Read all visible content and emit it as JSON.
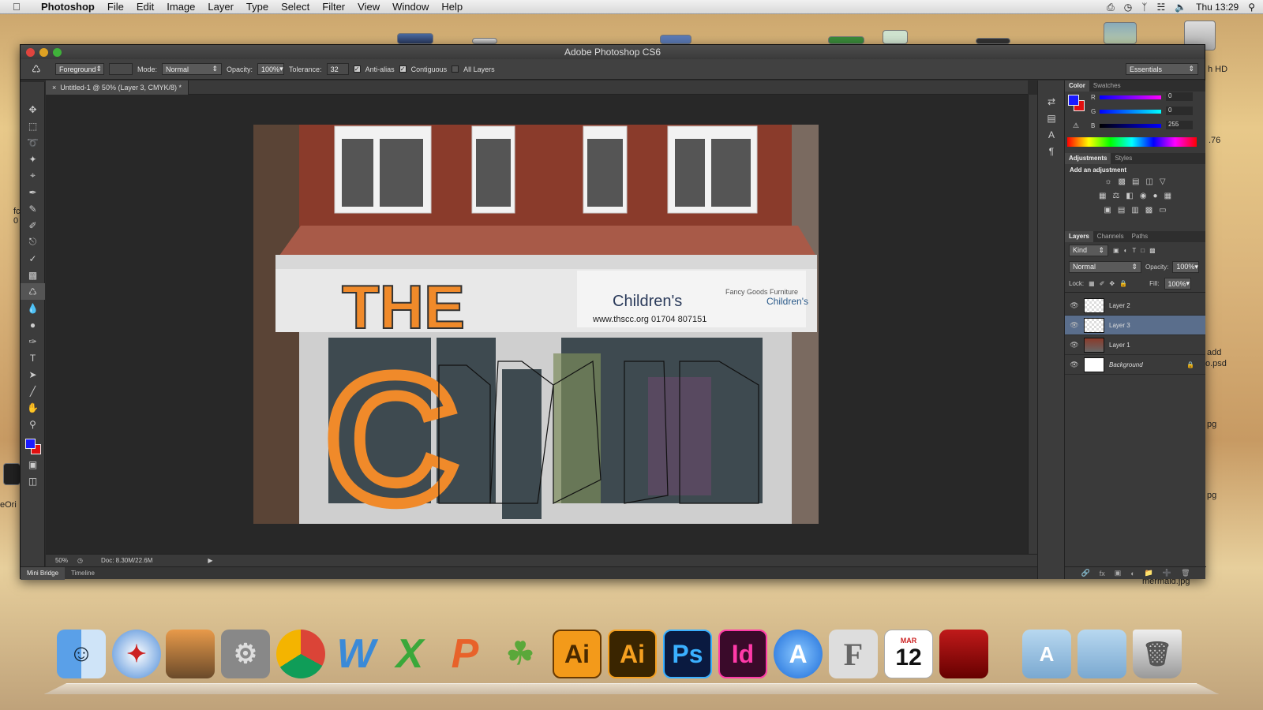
{
  "menubar": {
    "app_name": "Photoshop",
    "items": [
      "File",
      "Edit",
      "Image",
      "Layer",
      "Type",
      "Select",
      "Filter",
      "View",
      "Window",
      "Help"
    ],
    "clock": "Thu 13:29"
  },
  "window": {
    "title": "Adobe Photoshop CS6"
  },
  "options": {
    "tool_preset": "Foreground",
    "mode_label": "Mode:",
    "mode_value": "Normal",
    "opacity_label": "Opacity:",
    "opacity_value": "100%",
    "tolerance_label": "Tolerance:",
    "tolerance_value": "32",
    "antialias_label": "Anti-alias",
    "contiguous_label": "Contiguous",
    "all_layers_label": "All Layers",
    "workspace": "Essentials"
  },
  "document": {
    "tab_title": "Untitled-1 @ 50% (Layer 3, CMYK/8) *"
  },
  "photo": {
    "sign_line1": "Children's",
    "sign_line2": "www.thscc.org   01704 807151",
    "sign_side": "Fancy Goods Furniture",
    "sign_logo": "Children's",
    "word_the": "THE",
    "letter_c": "C"
  },
  "status": {
    "zoom": "50%",
    "doc": "Doc: 8.30M/22.6M"
  },
  "bottom_tabs": [
    "Mini Bridge",
    "Timeline"
  ],
  "color_panel": {
    "tabs": [
      "Color",
      "Swatches"
    ],
    "r_label": "R",
    "r_value": "0",
    "g_label": "G",
    "g_value": "0",
    "b_label": "B",
    "b_value": "255",
    "foreground": "#1a1aff",
    "background": "#e01010"
  },
  "adjustments_panel": {
    "tabs": [
      "Adjustments",
      "Styles"
    ],
    "heading": "Add an adjustment"
  },
  "layers_panel": {
    "tabs": [
      "Layers",
      "Channels",
      "Paths"
    ],
    "filter": "Kind",
    "blend_mode": "Normal",
    "opacity_label": "Opacity:",
    "opacity_value": "100%",
    "lock_label": "Lock:",
    "fill_label": "Fill:",
    "fill_value": "100%",
    "layers": [
      {
        "name": "Layer 2",
        "selected": false
      },
      {
        "name": "Layer 3",
        "selected": true
      },
      {
        "name": "Layer 1",
        "selected": false
      },
      {
        "name": "Background",
        "selected": false
      }
    ]
  },
  "desktop_labels": {
    "hd": "h HD",
    "n76": ".76",
    "add1": "add",
    "add2": "o.psd",
    "pg1": "pg",
    "pg2": "pg",
    "mermaid": "mermaid.jpg",
    "left1": "fc",
    "left2": "0",
    "left3": "eOri"
  },
  "dock": {
    "items": [
      {
        "name": "finder",
        "label": ""
      },
      {
        "name": "safari",
        "label": ""
      },
      {
        "name": "iphoto",
        "label": ""
      },
      {
        "name": "system-preferences",
        "label": ""
      },
      {
        "name": "chrome",
        "label": ""
      },
      {
        "name": "word",
        "label": "W"
      },
      {
        "name": "excel",
        "label": "X"
      },
      {
        "name": "powerpoint",
        "label": "P"
      },
      {
        "name": "frog-app",
        "label": ""
      },
      {
        "name": "illustrator-1",
        "label": "Ai"
      },
      {
        "name": "illustrator-2",
        "label": "Ai"
      },
      {
        "name": "photoshop",
        "label": "Ps"
      },
      {
        "name": "indesign",
        "label": "Id"
      },
      {
        "name": "app-store",
        "label": ""
      },
      {
        "name": "fontbook",
        "label": "F"
      },
      {
        "name": "calendar",
        "label": "12",
        "month": "MAR"
      },
      {
        "name": "photo-booth",
        "label": ""
      },
      {
        "name": "applications-folder",
        "label": ""
      },
      {
        "name": "documents-folder",
        "label": ""
      },
      {
        "name": "trash",
        "label": ""
      }
    ]
  }
}
